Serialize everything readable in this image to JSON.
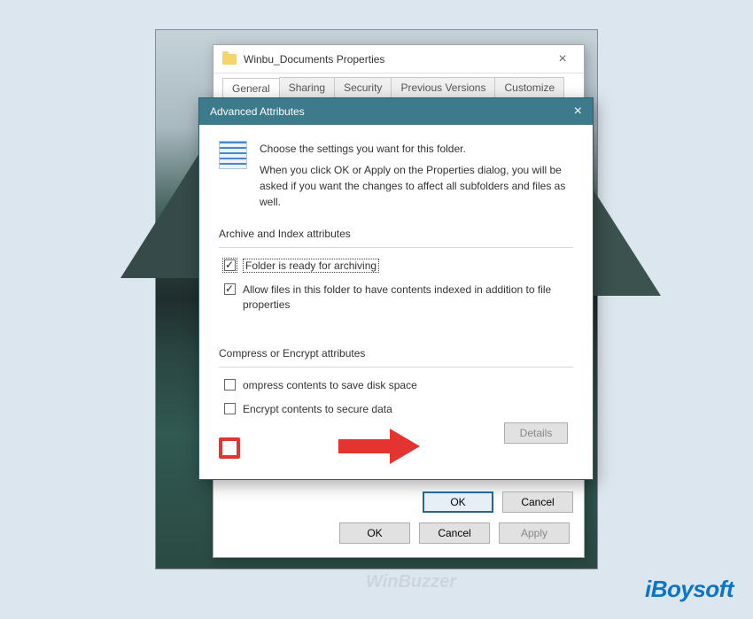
{
  "propertiesWindow": {
    "title": "Winbu_Documents Properties",
    "tabs": [
      {
        "label": "General"
      },
      {
        "label": "Sharing"
      },
      {
        "label": "Security"
      },
      {
        "label": "Previous Versions"
      },
      {
        "label": "Customize"
      }
    ],
    "buttons": {
      "ok": "OK",
      "cancel": "Cancel",
      "apply": "Apply"
    }
  },
  "advanced": {
    "title": "Advanced Attributes",
    "intro1": "Choose the settings you want for this folder.",
    "intro2": "When you click OK or Apply on the Properties dialog, you will be asked if you want the changes to affect all subfolders and files as well.",
    "group1": {
      "label": "Archive and Index attributes",
      "opt1": "Folder is ready for archiving",
      "opt2": "Allow files in this folder to have contents indexed in addition to file properties"
    },
    "group2": {
      "label": "Compress or Encrypt attributes",
      "opt1": "ompress contents to save disk space",
      "opt2": "Encrypt contents to secure data",
      "details": "Details"
    },
    "buttons": {
      "ok": "OK",
      "cancel": "Cancel"
    }
  },
  "watermark": "WinBuzzer",
  "brand": "iBoysoft"
}
